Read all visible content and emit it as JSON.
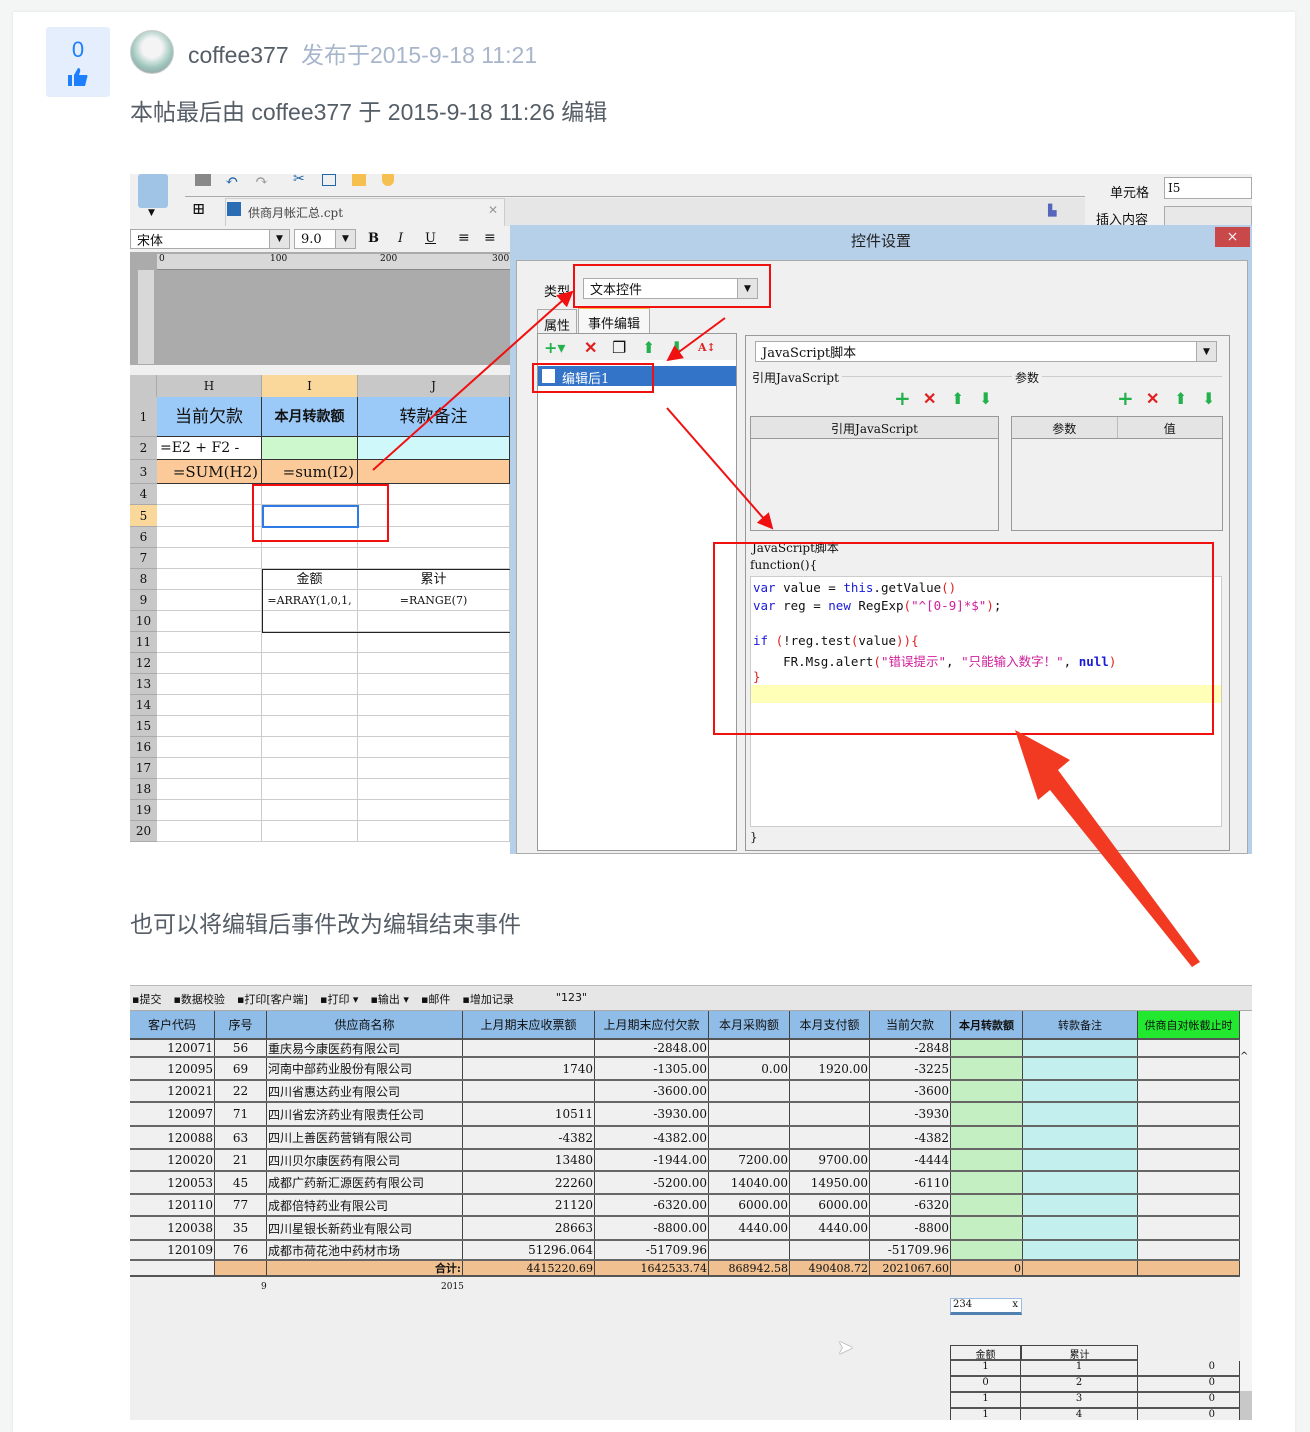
{
  "post": {
    "votes": "0",
    "username": "coffee377",
    "posted": "发布于2015-9-18 11:21",
    "edited": "本帖最后由 coffee377 于 2015-9-18 11:26 编辑",
    "caption": "也可以将编辑后事件改为编辑结束事件"
  },
  "designer": {
    "file_tab": "供商月帐汇总.cpt",
    "font_name": "宋体",
    "font_size": "9.0",
    "bold": "B",
    "italic": "I",
    "underline": "U",
    "ruler": [
      "0",
      "100",
      "200",
      "300"
    ],
    "cell_label": "单元格",
    "cell_value": "I5",
    "insert_label": "插入内容",
    "columns": [
      "H",
      "I",
      "J"
    ],
    "rows": [
      "1",
      "2",
      "3",
      "4",
      "5",
      "6",
      "7",
      "8",
      "9",
      "10",
      "11",
      "12",
      "13",
      "14",
      "15",
      "16",
      "17",
      "18",
      "19",
      "20"
    ],
    "cells": {
      "h1": "当前欠款",
      "i1": "本月转款额",
      "j1": "转款备注",
      "h2": "=E2 + F2 -",
      "h3": "=SUM(H2)",
      "i3": "=sum(I2)",
      "i8": "金额",
      "j8": "累计",
      "i9": "=ARRAY(1,0,1,",
      "j9": "=RANGE(7)"
    }
  },
  "dialog": {
    "title": "控件设置",
    "close": "×",
    "type_label": "类型",
    "type_value": "文本控件",
    "tabs": [
      "属性",
      "事件编辑"
    ],
    "event_item": "编辑后1",
    "script_type": "JavaScript脚本",
    "ref_js_label": "引用JavaScript",
    "params_label": "参数",
    "ref_js_col": "引用JavaScript",
    "param_col": "参数",
    "value_col": "值",
    "script_legend": "JavaScript脚本",
    "func_open": "function(){",
    "func_close": "}",
    "code": {
      "l1a": "var",
      "l1b": " value = ",
      "l1c": "this",
      "l1d": ".getValue",
      "l1e": "()",
      "l2a": "var",
      "l2b": " reg = ",
      "l2c": "new",
      "l2d": " RegExp",
      "l2e": "(",
      "l2f": "\"^[0-9]*$\"",
      "l2g": ")",
      "l2h": ";",
      "l3a": "if",
      "l3b": " (",
      "l3c": "!reg.test",
      "l3d": "(",
      "l3e": "value",
      "l3f": ")){",
      "l4a": "    FR.Msg.alert",
      "l4b": "(",
      "l4c": "\"错误提示\"",
      "l4d": ", ",
      "l4e": "\"只能输入数字！\"",
      "l4f": ", ",
      "l4g": "null",
      "l4h": ")",
      "l5": "}"
    }
  },
  "report": {
    "toolbar": [
      "提交",
      "数据校验",
      "打印[客户端]",
      "打印 ▾",
      "输出 ▾",
      "邮件",
      "增加记录",
      "\"123\""
    ],
    "headers": [
      "客户代码",
      "序号",
      "供应商名称",
      "上月期末应收票额",
      "上月期末应付欠款",
      "本月采购额",
      "本月支付额",
      "当前欠款",
      "本月转款额",
      "转款备注",
      "供商自对帐截止时"
    ],
    "rows": [
      [
        "120071",
        "56",
        "重庆易今康医药有限公司",
        "",
        "-2848.00",
        "",
        "",
        "-2848"
      ],
      [
        "120095",
        "69",
        "河南中部药业股份有限公司",
        "1740",
        "-1305.00",
        "0.00",
        "1920.00",
        "-3225"
      ],
      [
        "120021",
        "22",
        "四川省惠达药业有限公司",
        "",
        "-3600.00",
        "",
        "",
        "-3600"
      ],
      [
        "120097",
        "71",
        "四川省宏济药业有限责任公司",
        "10511",
        "-3930.00",
        "",
        "",
        "-3930"
      ],
      [
        "120088",
        "63",
        "四川上善医药营销有限公司",
        "-4382",
        "-4382.00",
        "",
        "",
        "-4382"
      ],
      [
        "120020",
        "21",
        "四川贝尔康医药有限公司",
        "13480",
        "-1944.00",
        "7200.00",
        "9700.00",
        "-4444"
      ],
      [
        "120053",
        "45",
        "成都广药新汇源医药有限公司",
        "22260",
        "-5200.00",
        "14040.00",
        "14950.00",
        "-6110"
      ],
      [
        "120110",
        "77",
        "成都倍特药业有限公司",
        "21120",
        "-6320.00",
        "6000.00",
        "6000.00",
        "-6320"
      ],
      [
        "120038",
        "35",
        "四川星银长新药业有限公司",
        "28663",
        "-8800.00",
        "4440.00",
        "4440.00",
        "-8800"
      ],
      [
        "120109",
        "76",
        "成都市荷花池中药材市场",
        "51296.064",
        "-51709.96",
        "",
        "",
        "-51709.96"
      ]
    ],
    "total": {
      "label": "合计:",
      "values": [
        "4415220.69",
        "1642533.74",
        "868942.58",
        "490408.72",
        "2021067.60",
        "0"
      ]
    },
    "below": {
      "month": "9",
      "year": "2015",
      "input_value": "234",
      "input_clear": "x"
    },
    "mini_table": {
      "headers": [
        "金额",
        "累计"
      ],
      "rows": [
        [
          "1",
          "1",
          "0"
        ],
        [
          "0",
          "2",
          "0"
        ],
        [
          "1",
          "3",
          "0"
        ],
        [
          "1",
          "4",
          "0"
        ]
      ]
    }
  },
  "colors": {
    "accent": "#1e80ff",
    "header_blue": "#8fbde8",
    "total_orange": "#f0c090",
    "green_col": "#c3efc3",
    "cyan_col": "#c3f0ee",
    "annotation_red": "#f01010"
  }
}
